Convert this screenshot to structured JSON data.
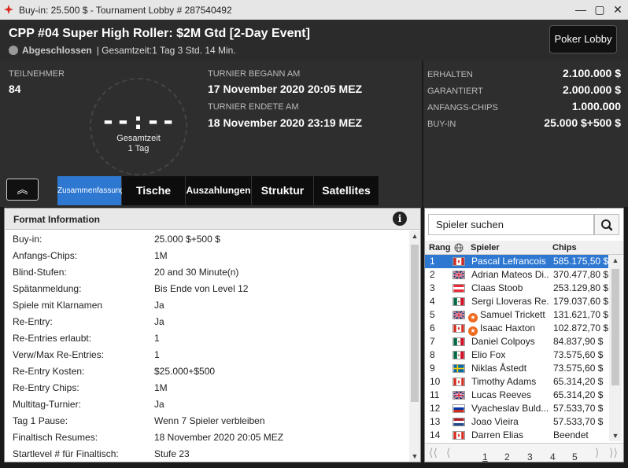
{
  "titlebar": {
    "title": "Buy-in: 25.500 $ - Tournament Lobby # 287540492",
    "minimize": "—",
    "maximize": "▢",
    "close": "✕"
  },
  "header": {
    "tournament_name": "CPP #04 Super High Roller: $2M Gtd [2-Day Event]",
    "status": "Abgeschlossen",
    "total_time": "| Gesamtzeit:1 Tag 3 Std.  14 Min.",
    "lobby_button": "Poker Lobby"
  },
  "info": {
    "participants_label": "TEILNEHMER",
    "participants_value": "84",
    "clock_time": "--:--",
    "clock_label": "Gesamtzeit",
    "clock_sub": "1 Tag",
    "start_label": "TURNIER BEGANN AM",
    "start_value": "17 November 2020  20:05 MEZ",
    "end_label": "TURNIER ENDETE AM",
    "end_value": "18 November 2020  23:19 MEZ"
  },
  "prize": {
    "received_label": "ERHALTEN",
    "received_value": "2.100.000 $",
    "guaranteed_label": "GARANTIERT",
    "guaranteed_value": "2.000.000 $",
    "start_chips_label": "ANFANGS-CHIPS",
    "start_chips_value": "1.000.000",
    "buyin_label": "BUY-IN",
    "buyin_value": "25.000 $+500 $"
  },
  "tabs": {
    "collapse": "︽",
    "items": [
      "Zusammenfassung",
      "Tische",
      "Auszahlungen",
      "Struktur",
      "Satellites"
    ]
  },
  "format": {
    "title": "Format Information",
    "info_icon": "i",
    "rows": [
      {
        "k": "Buy-in:",
        "v": "25.000 $+500 $"
      },
      {
        "k": "Anfangs-Chips:",
        "v": "1M"
      },
      {
        "k": "Blind-Stufen:",
        "v": "20 and 30 Minute(n)"
      },
      {
        "k": "Spätanmeldung:",
        "v": "Bis Ende von Level 12"
      },
      {
        "k": "Spiele mit Klarnamen",
        "v": "Ja"
      },
      {
        "k": "Re-Entry:",
        "v": "Ja"
      },
      {
        "k": "Re-Entries erlaubt:",
        "v": "1"
      },
      {
        "k": "Verw/Max Re-Entries:",
        "v": "1"
      },
      {
        "k": "Re-Entry Kosten:",
        "v": "$25.000+$500"
      },
      {
        "k": "Re-Entry Chips:",
        "v": "1M"
      },
      {
        "k": "Multitag-Turnier:",
        "v": "Ja"
      },
      {
        "k": "Tag 1 Pause:",
        "v": "Wenn 7 Spieler verbleiben"
      },
      {
        "k": "Finaltisch Resumes:",
        "v": "18 November 2020  20:05 MEZ"
      },
      {
        "k": "Startlevel # für  Finaltisch:",
        "v": "Stufe 23"
      }
    ]
  },
  "players": {
    "search_placeholder": "Spieler suchen",
    "col_rank": "Rang",
    "col_player": "Spieler",
    "col_chips": "Chips",
    "rows": [
      {
        "rank": "1",
        "flag": "ca",
        "name": "Pascal Lefrancois",
        "chips": "585.175,50 $",
        "badge": false
      },
      {
        "rank": "2",
        "flag": "gb",
        "name": "Adrian Mateos Di...",
        "chips": "370.477,80 $",
        "badge": false
      },
      {
        "rank": "3",
        "flag": "at",
        "name": "Claas Stoob",
        "chips": "253.129,80 $",
        "badge": false
      },
      {
        "rank": "4",
        "flag": "mx",
        "name": "Sergi Lloveras Re...",
        "chips": "179.037,60 $",
        "badge": false
      },
      {
        "rank": "5",
        "flag": "gb",
        "name": "Samuel Trickett",
        "chips": "131.621,70 $",
        "badge": true
      },
      {
        "rank": "6",
        "flag": "ca",
        "name": "Isaac Haxton",
        "chips": "102.872,70 $",
        "badge": true
      },
      {
        "rank": "7",
        "flag": "mx",
        "name": "Daniel Colpoys",
        "chips": "84.837,90 $",
        "badge": false
      },
      {
        "rank": "8",
        "flag": "mx",
        "name": "Elio Fox",
        "chips": "73.575,60 $",
        "badge": false
      },
      {
        "rank": "9",
        "flag": "se",
        "name": "Niklas Åstedt",
        "chips": "73.575,60 $",
        "badge": false
      },
      {
        "rank": "10",
        "flag": "ca",
        "name": "Timothy Adams",
        "chips": "65.314,20 $",
        "badge": false
      },
      {
        "rank": "11",
        "flag": "gb",
        "name": "Lucas Reeves",
        "chips": "65.314,20 $",
        "badge": false
      },
      {
        "rank": "12",
        "flag": "ru",
        "name": "Vyacheslav Buld...",
        "chips": "57.533,70 $",
        "badge": false
      },
      {
        "rank": "13",
        "flag": "nl",
        "name": "Joao Vieira",
        "chips": "57.533,70 $",
        "badge": false
      },
      {
        "rank": "14",
        "flag": "ca",
        "name": "Darren Elias",
        "chips": "Beendet",
        "badge": false
      }
    ],
    "pages": [
      "1",
      "2",
      "3",
      "4",
      "5"
    ],
    "current_page": 1
  }
}
